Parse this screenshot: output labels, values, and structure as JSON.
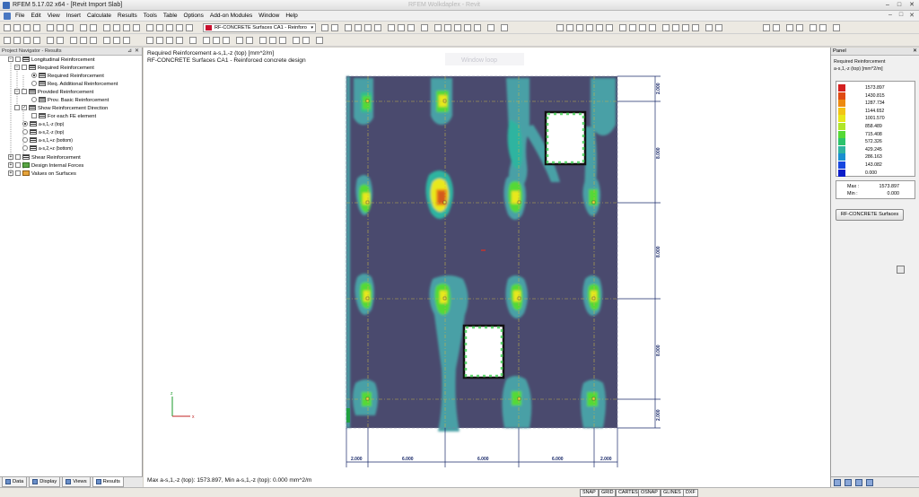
{
  "window": {
    "title": "RFEM 5.17.02 x64 - [Revit Import Slab]",
    "ghost_title": "RFEM Wolkdaplex - Revit",
    "min": "–",
    "max": "□",
    "close": "✕"
  },
  "menu": [
    "File",
    "Edit",
    "View",
    "Insert",
    "Calculate",
    "Results",
    "Tools",
    "Table",
    "Options",
    "Add-on Modules",
    "Window",
    "Help"
  ],
  "toolbar": {
    "case_dropdown": "RF-CONCRETE Surfaces CA1 - Reinforo",
    "dropdown_arrow": "▾"
  },
  "navigator": {
    "title": "Project Navigator - Results",
    "pin": "⊿",
    "close": "✕",
    "items": [
      {
        "label": "Longitudinal Reinforcement",
        "ctl": "−"
      },
      {
        "label": "Required Reinforcement",
        "ctl": "−"
      },
      {
        "label": "Required Reinforcement"
      },
      {
        "label": "Req. Additional Reinforcement"
      },
      {
        "label": "Provided Reinforcement",
        "ctl": "−"
      },
      {
        "label": "Prov. Basic Reinforcement"
      },
      {
        "label": "Show Reinforcement Direction",
        "ctl": "✓"
      },
      {
        "label": "For each FE element"
      },
      {
        "label": "a-s,1,-z (top)"
      },
      {
        "label": "a-s,2,-z (top)"
      },
      {
        "label": "a-s,1,+z (bottom)"
      },
      {
        "label": "a-s,2,+z (bottom)"
      },
      {
        "label": "Shear Reinforcement",
        "ctl": "+"
      },
      {
        "label": "Design Internal Forces",
        "ctl": "+"
      },
      {
        "label": "Values on Surfaces",
        "ctl": "+"
      }
    ],
    "tabs": [
      "Data",
      "Display",
      "Views",
      "Results"
    ]
  },
  "workspace": {
    "caption_line1": "Required Reinforcement a-s,1,-z (top) [mm^2/m]",
    "caption_line2": "RF-CONCRETE Surfaces CA1 - Reinforced concrete design",
    "status_text": "Max a-s,1,-z (top): 1573.897, Min a-s,1,-z (top): 0.000 mm^2/m",
    "window_ghost": "Window loop",
    "axis_z": "z",
    "axis_x": "x",
    "dim_right": [
      "2.000",
      "8.000",
      "8.000",
      "8.000",
      "2.000"
    ],
    "dim_bottom": [
      "2.000",
      "6.000",
      "6.000",
      "6.000",
      "2.000"
    ]
  },
  "panel": {
    "title": "Panel",
    "close": "✕",
    "result_title": "Required Reinforcement",
    "result_subtitle": "a-s,1,-z (top) [mm^2/m]",
    "legend": [
      {
        "value": "1573.897",
        "color": "#d42020"
      },
      {
        "value": "1430.815",
        "color": "#e04a12"
      },
      {
        "value": "1287.734",
        "color": "#ed8a10"
      },
      {
        "value": "1144.652",
        "color": "#f3c415"
      },
      {
        "value": "1001.570",
        "color": "#e8e81a"
      },
      {
        "value": "858.489",
        "color": "#b0e62a"
      },
      {
        "value": "715.408",
        "color": "#55d935"
      },
      {
        "value": "572.326",
        "color": "#2cc36c"
      },
      {
        "value": "429.245",
        "color": "#2fb4a0"
      },
      {
        "value": "286.163",
        "color": "#1a8fd0"
      },
      {
        "value": "143.082",
        "color": "#1646e0"
      },
      {
        "value": "0.000",
        "color": "#0a1cc8"
      }
    ],
    "max_label": "Max :",
    "max_value": "1573.897",
    "min_label": "Min :",
    "min_value": "0.000",
    "button": "RF-CONCRETE Surfaces"
  },
  "statusbar": [
    "SNAP",
    "GRID",
    "CARTES",
    "OSNAP",
    "GLINES",
    "DXF"
  ],
  "colors": {
    "slab": "#4a4a6e",
    "contour_low": "#4aa0a6",
    "contour_mid": "#5fd66f",
    "contour_high": "#e8e81a",
    "contour_peak": "#d45a1a"
  }
}
